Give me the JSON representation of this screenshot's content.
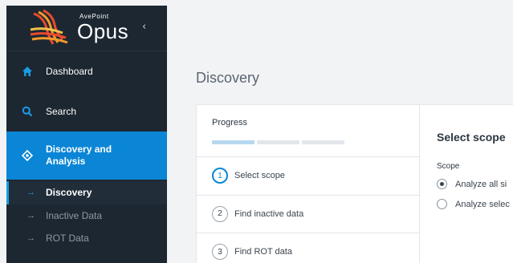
{
  "brand": {
    "company": "AvePoint",
    "product": "Opus",
    "collapse_glyph": "‹"
  },
  "sidebar": {
    "items": [
      {
        "label": "Dashboard",
        "icon": "home-icon"
      },
      {
        "label": "Search",
        "icon": "search-icon"
      },
      {
        "label": "Discovery and Analysis",
        "icon": "discovery-icon",
        "active": true
      }
    ],
    "subitems": [
      {
        "label": "Discovery",
        "active": true
      },
      {
        "label": "Inactive Data"
      },
      {
        "label": "ROT Data"
      }
    ]
  },
  "main": {
    "title": "Discovery",
    "progress": {
      "label": "Progress",
      "completed_segments": 1,
      "total_segments": 3
    },
    "steps": [
      {
        "number": "1",
        "label": "Select scope",
        "current": true
      },
      {
        "number": "2",
        "label": "Find inactive data"
      },
      {
        "number": "3",
        "label": "Find ROT data"
      }
    ],
    "scope_panel": {
      "title": "Select scope",
      "field_label": "Scope",
      "options": [
        {
          "label": "Analyze all si",
          "checked": true
        },
        {
          "label": "Analyze selec",
          "checked": false
        }
      ]
    }
  },
  "colors": {
    "sidebar_bg": "#1d2731",
    "accent": "#0b86d6",
    "progress_done": "#b7d7ef",
    "logo_orange": "#e84c2f"
  }
}
